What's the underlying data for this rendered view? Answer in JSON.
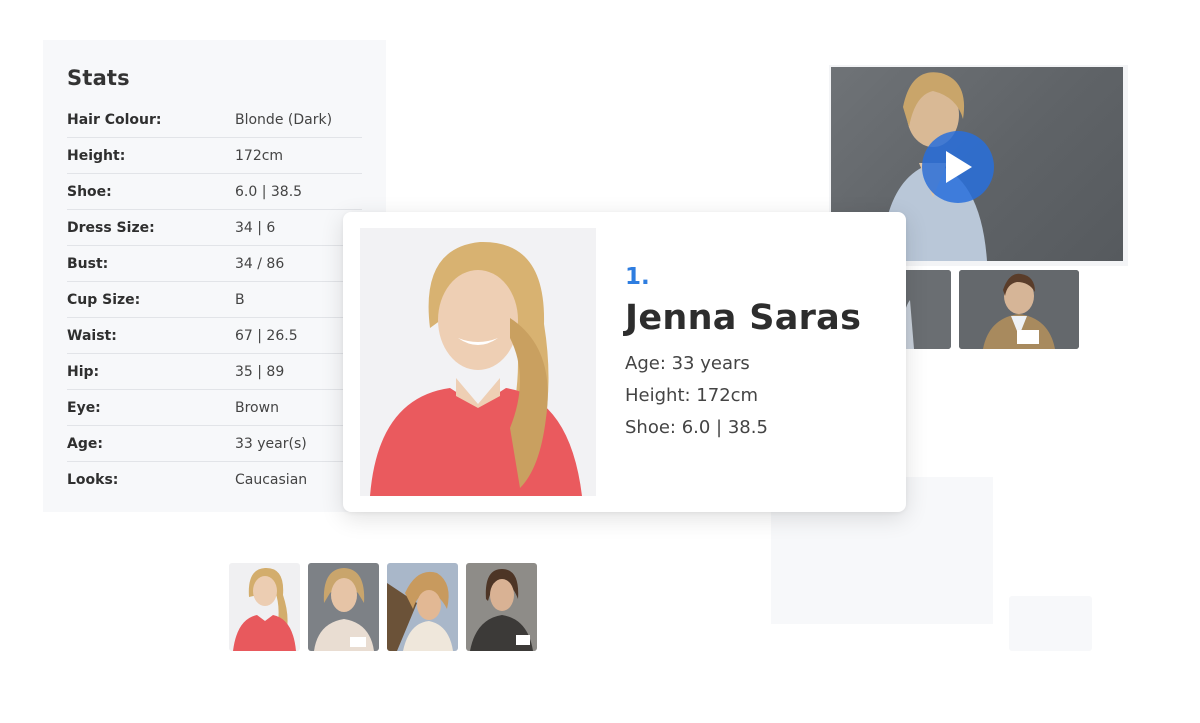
{
  "stats": {
    "title": "Stats",
    "rows": [
      {
        "label": "Hair Colour:",
        "value": "Blonde (Dark)"
      },
      {
        "label": "Height:",
        "value": "172cm"
      },
      {
        "label": "Shoe:",
        "value": "6.0 | 38.5"
      },
      {
        "label": "Dress Size:",
        "value": "34 | 6"
      },
      {
        "label": "Bust:",
        "value": "34 / 86"
      },
      {
        "label": "Cup Size:",
        "value": "B"
      },
      {
        "label": "Waist:",
        "value": "67 | 26.5"
      },
      {
        "label": "Hip:",
        "value": "35 | 89"
      },
      {
        "label": "Eye:",
        "value": "Brown"
      },
      {
        "label": "Age:",
        "value": "33 year(s)"
      },
      {
        "label": "Looks:",
        "value": "Caucasian"
      }
    ]
  },
  "featured": {
    "rank": "1.",
    "name": "Jenna Saras",
    "age": "Age: 33 years",
    "height": "Height: 172cm",
    "shoe": "Shoe: 6.0 | 38.5"
  },
  "video": {
    "play_icon": "play-icon"
  },
  "colors": {
    "accent": "#2e7de0",
    "panel_bg": "#f7f8fa"
  }
}
